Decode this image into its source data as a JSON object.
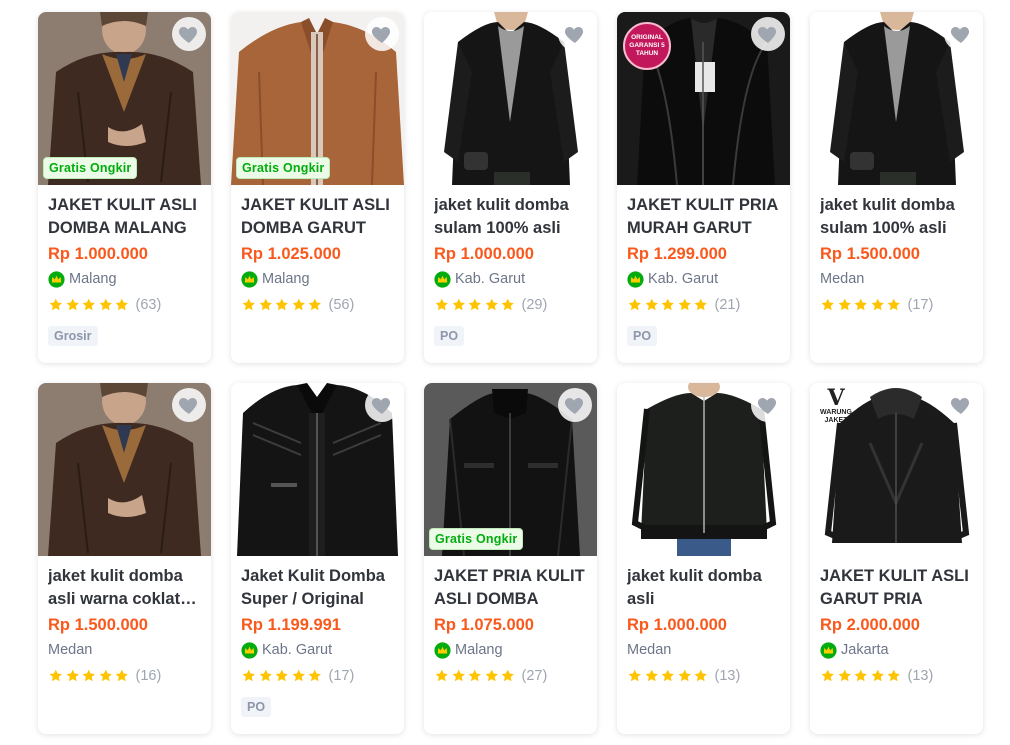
{
  "colors": {
    "price": "#fa591d",
    "ongkir_green": "#03ac0e",
    "star": "#ffc400",
    "heart": "#9fa6b0"
  },
  "icons": {
    "wishlist": "heart-icon",
    "shop_badge": "power-merchant-crown-icon",
    "star": "star-icon"
  },
  "products": [
    {
      "title": "JAKET KULIT ASLI DOMBA MALANG",
      "price": "Rp 1.000.000",
      "location": "Malang",
      "badge": true,
      "rating_count": "(63)",
      "stars": 5,
      "free_shipping": "Gratis Ongkir",
      "tag": "Grosir",
      "photo": "brown-jacket-man",
      "overlay": ""
    },
    {
      "title": "JAKET KULIT ASLI DOMBA GARUT",
      "price": "Rp 1.025.000",
      "location": "Malang",
      "badge": true,
      "rating_count": "(56)",
      "stars": 5,
      "free_shipping": "Gratis Ongkir",
      "tag": "",
      "photo": "tan-jacket",
      "overlay": ""
    },
    {
      "title": "jaket kulit domba sulam 100% asli",
      "price": "Rp 1.000.000",
      "location": "Kab. Garut",
      "badge": true,
      "rating_count": "(29)",
      "stars": 5,
      "free_shipping": "",
      "tag": "PO",
      "photo": "black-jacket-man",
      "overlay": ""
    },
    {
      "title": "JAKET KULIT PRIA MURAH GARUT",
      "price": "Rp 1.299.000",
      "location": "Kab. Garut",
      "badge": true,
      "rating_count": "(21)",
      "stars": 5,
      "free_shipping": "",
      "tag": "PO",
      "photo": "black-jacket-zip",
      "overlay": "ORIGINAL GARANSI 5 TAHUN"
    },
    {
      "title": "jaket kulit domba sulam 100% asli",
      "price": "Rp 1.500.000",
      "location": "Medan",
      "badge": false,
      "rating_count": "(17)",
      "stars": 5,
      "free_shipping": "",
      "tag": "",
      "photo": "black-jacket-man",
      "overlay": ""
    },
    {
      "title": "jaket kulit domba asli warna coklat tua",
      "price": "Rp 1.500.000",
      "location": "Medan",
      "badge": false,
      "rating_count": "(16)",
      "stars": 5,
      "free_shipping": "",
      "tag": "",
      "photo": "brown-jacket-man",
      "overlay": ""
    },
    {
      "title": "Jaket Kulit Domba Super / Original",
      "price": "Rp 1.199.991",
      "location": "Kab. Garut",
      "badge": true,
      "rating_count": "(17)",
      "stars": 5,
      "free_shipping": "",
      "tag": "PO",
      "photo": "black-biker-jacket",
      "overlay": ""
    },
    {
      "title": "JAKET PRIA KULIT ASLI DOMBA",
      "price": "Rp 1.075.000",
      "location": "Malang",
      "badge": true,
      "rating_count": "(27)",
      "stars": 5,
      "free_shipping": "Gratis Ongkir",
      "tag": "",
      "photo": "black-jacket-collar",
      "overlay": ""
    },
    {
      "title": "jaket kulit domba asli",
      "price": "Rp 1.000.000",
      "location": "Medan",
      "badge": false,
      "rating_count": "(13)",
      "stars": 5,
      "free_shipping": "",
      "tag": "",
      "photo": "black-bomber-man",
      "overlay": ""
    },
    {
      "title": "JAKET KULIT ASLI GARUT PRIA",
      "price": "Rp 2.000.000",
      "location": "Jakarta",
      "badge": true,
      "rating_count": "(13)",
      "stars": 5,
      "free_shipping": "",
      "tag": "",
      "photo": "black-hooded-jacket",
      "overlay": "WARUNG JAKET"
    }
  ]
}
